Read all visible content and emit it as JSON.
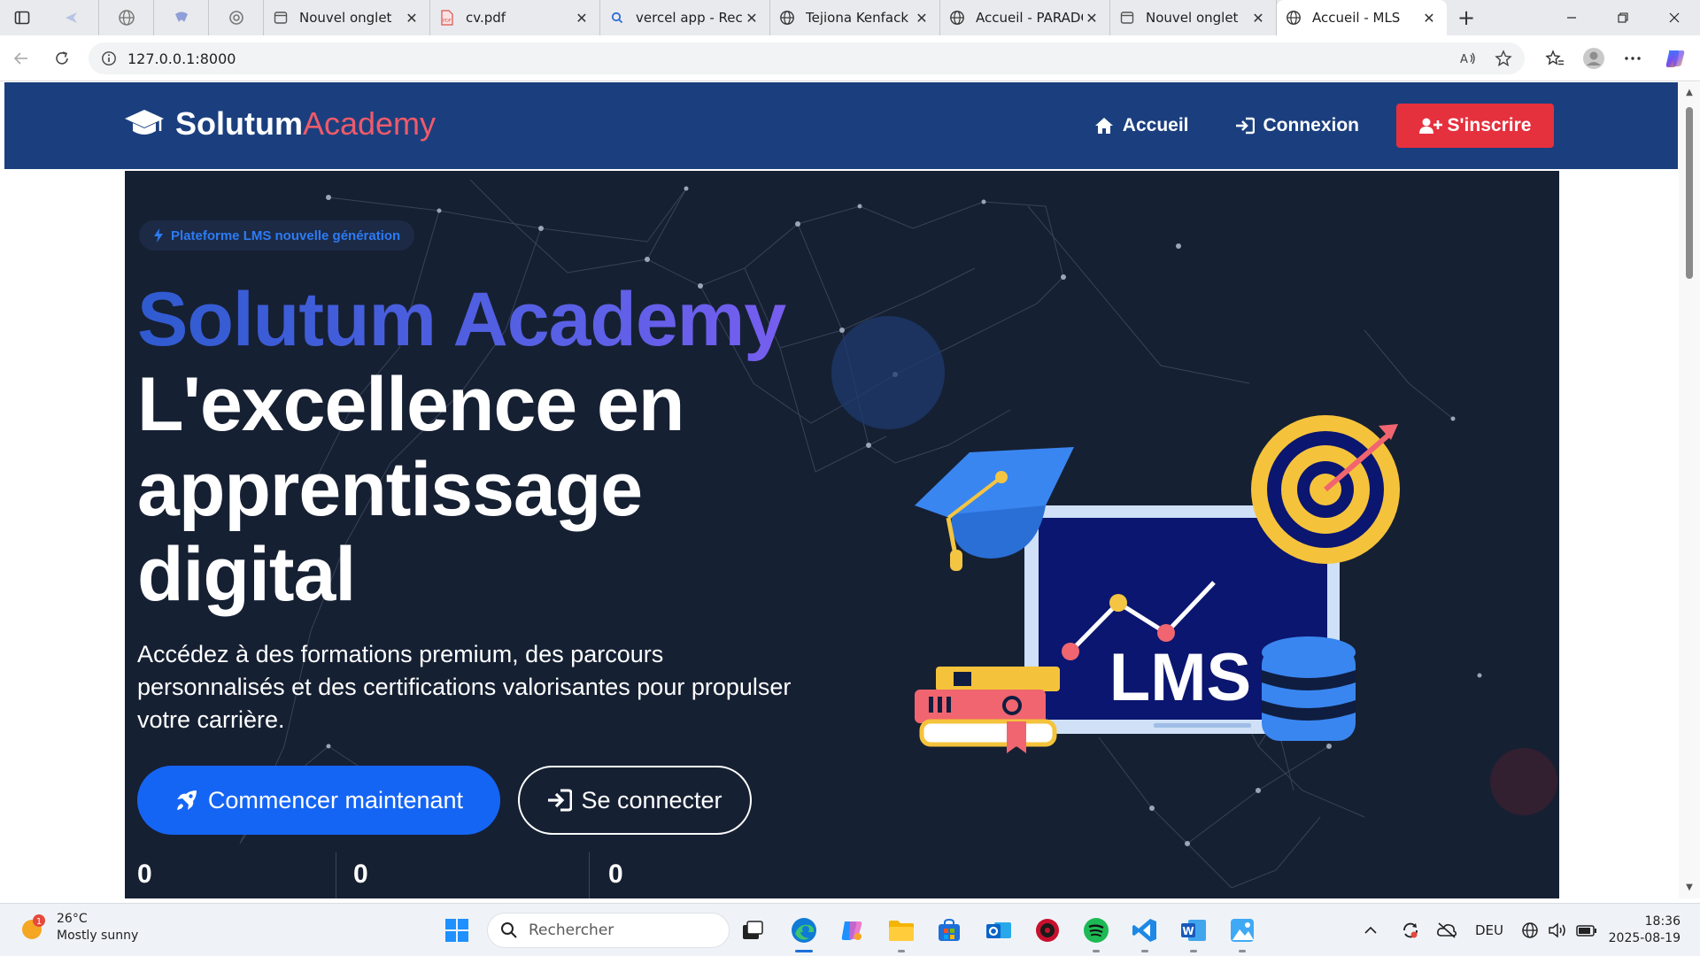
{
  "browser": {
    "tabs": [
      {
        "label": "Nouvel onglet"
      },
      {
        "label": "cv.pdf"
      },
      {
        "label": "vercel app - Rech"
      },
      {
        "label": "Tejiona Kenfack A"
      },
      {
        "label": "Accueil - PARADC"
      },
      {
        "label": "Nouvel onglet"
      },
      {
        "label": "Accueil - MLS",
        "active": true
      }
    ],
    "new_tab_label": "+",
    "url": "127.0.0.1:8000"
  },
  "site": {
    "brand_main": "Solutum",
    "brand_accent": "Academy",
    "nav": {
      "home": "Accueil",
      "login": "Connexion",
      "signup": "S'inscrire"
    }
  },
  "hero": {
    "badge": "Plateforme LMS nouvelle génération",
    "title_highlight": "Solutum Academy",
    "title_line2": "L'excellence en",
    "title_line3": "apprentissage",
    "title_line4": "digital",
    "subtitle_line1": "Accédez à des formations premium, des parcours",
    "subtitle_line2": "personnalisés et des certifications valorisantes pour propulser",
    "subtitle_line3": "votre carrière.",
    "cta_primary": "Commencer maintenant",
    "cta_secondary": "Se connecter",
    "stats": [
      "0",
      "0",
      "0"
    ],
    "illustration_label": "LMS"
  },
  "taskbar": {
    "weather_badge": "1",
    "temperature": "26°C",
    "weather_desc": "Mostly sunny",
    "search_placeholder": "Rechercher",
    "language": "DEU",
    "time": "18:36",
    "date": "2025-08-19"
  },
  "colors": {
    "nav_bg": "#1b3f7e",
    "brand_accent": "#ef5a6a",
    "signup_bg": "#e5303d",
    "hero_bg": "#162033",
    "primary_btn": "#1565f5",
    "badge_text": "#2d7bf4"
  }
}
